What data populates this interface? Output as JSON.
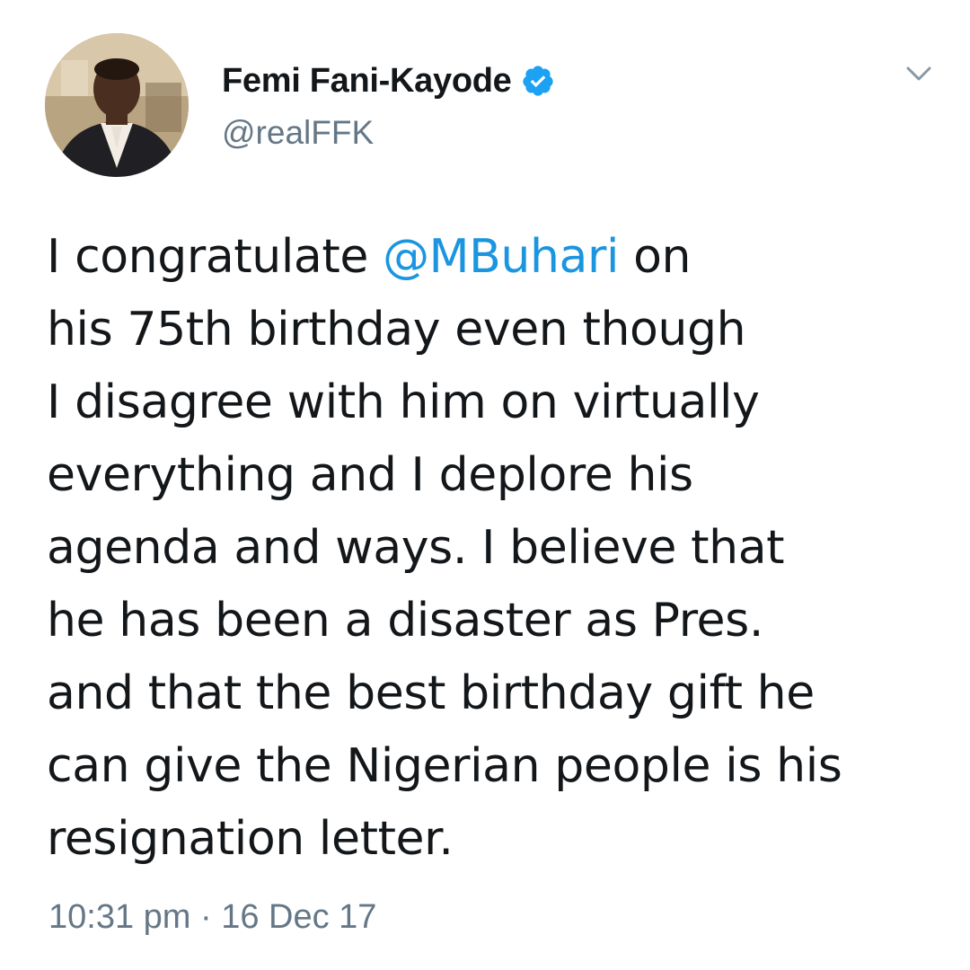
{
  "author": {
    "display_name": "Femi Fani-Kayode",
    "handle": "@realFFK",
    "verified": true,
    "avatar_icon": "profile-photo"
  },
  "tweet": {
    "lines": [
      {
        "pre": "I congratulate ",
        "mention": "@MBuhari",
        "post": " on"
      },
      {
        "text": "his 75th birthday even though"
      },
      {
        "text": "I disagree with him on virtually"
      },
      {
        "text": "everything and I deplore his"
      },
      {
        "text": "agenda and ways. I believe that"
      },
      {
        "text": "he has been a disaster as Pres."
      },
      {
        "text": "and that the best birthday gift he"
      },
      {
        "text": "can give the Nigerian people is his"
      },
      {
        "text": "resignation letter."
      }
    ]
  },
  "meta": {
    "timestamp": "10:31 pm · 16 Dec 17"
  },
  "icons": {
    "verified": "verified-badge-icon",
    "menu": "chevron-down-icon"
  },
  "colors": {
    "text": "#14171a",
    "secondary": "#657786",
    "mention": "#1b95e0",
    "verified": "#1da1f2"
  }
}
